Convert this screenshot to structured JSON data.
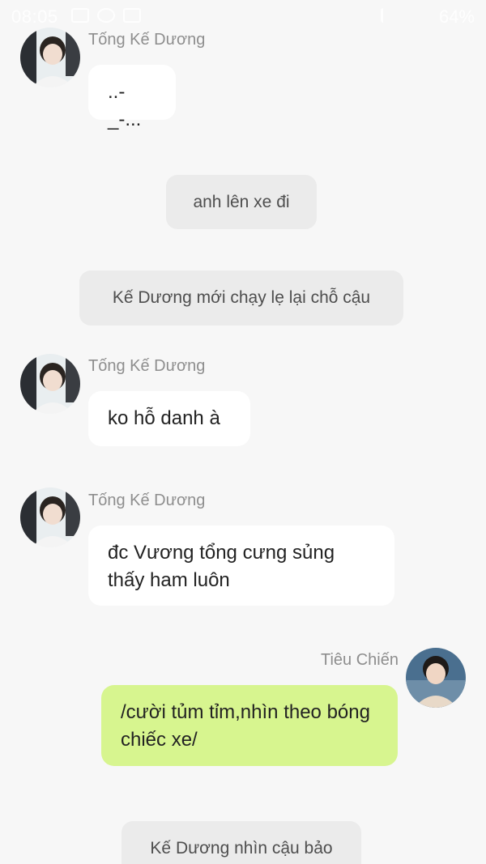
{
  "status_bar": {
    "time": "08:05",
    "battery": "64%"
  },
  "colors": {
    "background": "#f7f7f7",
    "incoming_bubble": "#ffffff",
    "outgoing_bubble": "#d7f58f",
    "system_bubble": "#ebebeb"
  },
  "messages": [
    {
      "type": "incoming",
      "sender": "Tống Kế Dương",
      "text": "..-_-..."
    },
    {
      "type": "system",
      "text": "anh lên xe đi"
    },
    {
      "type": "system",
      "text": "Kế Dương mới chạy lẹ lại chỗ cậu"
    },
    {
      "type": "incoming",
      "sender": "Tống Kế Dương",
      "text": "ko hỗ danh à"
    },
    {
      "type": "incoming",
      "sender": "Tống Kế Dương",
      "text": "đc Vương tổng cưng sủng thấy ham luôn"
    },
    {
      "type": "outgoing",
      "sender": "Tiêu Chiến",
      "text": "/cười tủm tỉm,nhìn theo bóng chiếc xe/"
    },
    {
      "type": "system",
      "text": "Kế Dương nhìn cậu bảo"
    }
  ]
}
